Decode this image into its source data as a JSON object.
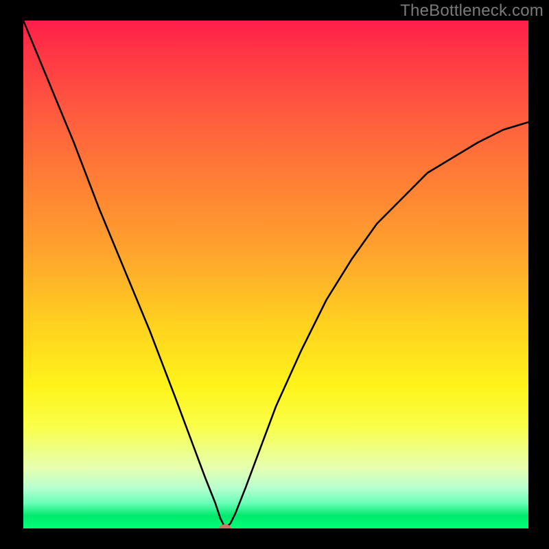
{
  "watermark": "TheBottleneck.com",
  "chart_data": {
    "type": "line",
    "title": "",
    "xlabel": "",
    "ylabel": "",
    "xlim": [
      0,
      100
    ],
    "ylim": [
      0,
      100
    ],
    "marker": {
      "x": 40,
      "y": 0
    },
    "series": [
      {
        "name": "curve",
        "x": [
          0,
          5,
          10,
          15,
          20,
          25,
          30,
          33,
          36,
          38,
          39,
          40,
          41,
          42,
          44,
          47,
          50,
          55,
          60,
          65,
          70,
          75,
          80,
          85,
          90,
          95,
          100
        ],
        "values": [
          100,
          88,
          76,
          63,
          51,
          39,
          26,
          18,
          10,
          5,
          2,
          0,
          1,
          3,
          8,
          16,
          24,
          35,
          45,
          53,
          60,
          65,
          70,
          73,
          76,
          78.5,
          80
        ]
      }
    ],
    "grid": false,
    "legend": false,
    "background_gradient": {
      "stops": [
        {
          "pos": 0,
          "color": "#ff1e4a"
        },
        {
          "pos": 72,
          "color": "#fff31a"
        },
        {
          "pos": 100,
          "color": "#00ff78"
        }
      ]
    }
  }
}
